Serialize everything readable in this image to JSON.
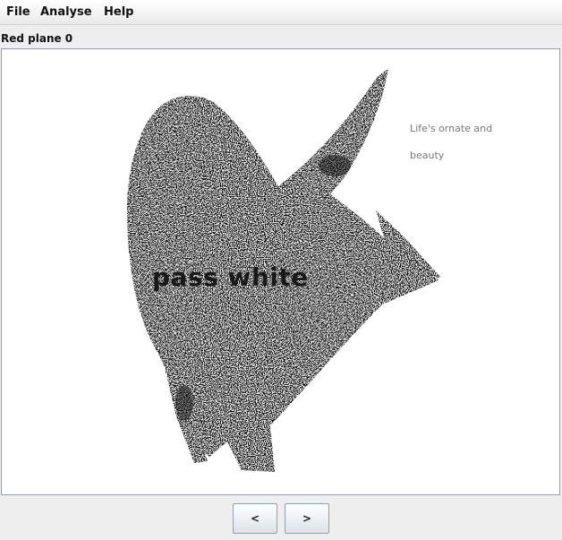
{
  "menu": {
    "file": "File",
    "analyse": "Analyse",
    "help": "Help"
  },
  "plane_label": "Red plane 0",
  "overlay": {
    "main_text": "pass white",
    "small_line_1": "Life's ornate and",
    "small_line_2": "beauty"
  },
  "buttons": {
    "prev": "<",
    "next": ">"
  },
  "colors": {
    "accent_border": "#8fa2b8",
    "noise_dark": "#111111"
  }
}
